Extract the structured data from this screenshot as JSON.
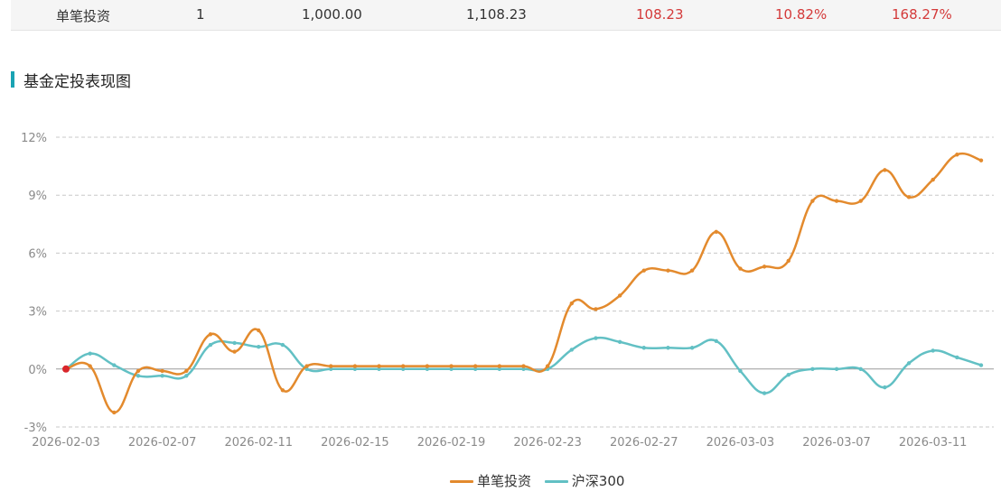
{
  "summary": {
    "name": "单笔投资",
    "count": "1",
    "principal": "1,000.00",
    "value": "1,108.23",
    "profit": "108.23",
    "return_rate": "10.82%",
    "annual_rate": "168.27%"
  },
  "section_title": "基金定投表现图",
  "colors": {
    "series1": "#e38a2d",
    "series2": "#62c0c4",
    "start_dot": "#d9262b",
    "profit_red": "#d43a3a",
    "accent": "#1aa3b3"
  },
  "chart_data": {
    "type": "line",
    "title": "",
    "xlabel": "",
    "ylabel": "",
    "ylim": [
      -3,
      12
    ],
    "yticks": [
      -3,
      0,
      3,
      6,
      9,
      12
    ],
    "ytick_labels": [
      "-3%",
      "0%",
      "3%",
      "6%",
      "9%",
      "12%"
    ],
    "xtick_labels": [
      "2026-02-03",
      "2026-02-07",
      "2026-02-11",
      "2026-02-15",
      "2026-02-19",
      "2026-02-23",
      "2026-02-27",
      "2026-03-03",
      "2026-03-07",
      "2026-03-11"
    ],
    "xtick_every": 4,
    "smooth": true,
    "grid": "horizontal-dashed",
    "legend_position": "bottom-center",
    "series": [
      {
        "name": "单笔投资",
        "values": [
          0.0,
          0.15,
          -2.25,
          -0.1,
          -0.1,
          -0.1,
          1.8,
          0.9,
          2.0,
          -1.1,
          0.15,
          0.15,
          0.15,
          0.15,
          0.15,
          0.15,
          0.15,
          0.15,
          0.15,
          0.15,
          0.15,
          3.4,
          3.1,
          3.8,
          5.1,
          5.1,
          5.1,
          7.1,
          5.2,
          5.3,
          5.6,
          8.7,
          8.7,
          8.7,
          10.3,
          8.9,
          9.8,
          11.1,
          10.8
        ]
      },
      {
        "name": "沪深300",
        "values": [
          0.0,
          0.8,
          0.2,
          -0.35,
          -0.35,
          -0.35,
          1.25,
          1.35,
          1.15,
          1.25,
          0.0,
          0.0,
          0.0,
          0.0,
          0.0,
          0.0,
          0.0,
          0.0,
          0.0,
          0.0,
          0.0,
          1.0,
          1.6,
          1.4,
          1.1,
          1.1,
          1.1,
          1.45,
          -0.1,
          -1.25,
          -0.3,
          0.0,
          0.0,
          0.0,
          -0.95,
          0.3,
          0.95,
          0.6,
          0.2
        ]
      }
    ]
  }
}
